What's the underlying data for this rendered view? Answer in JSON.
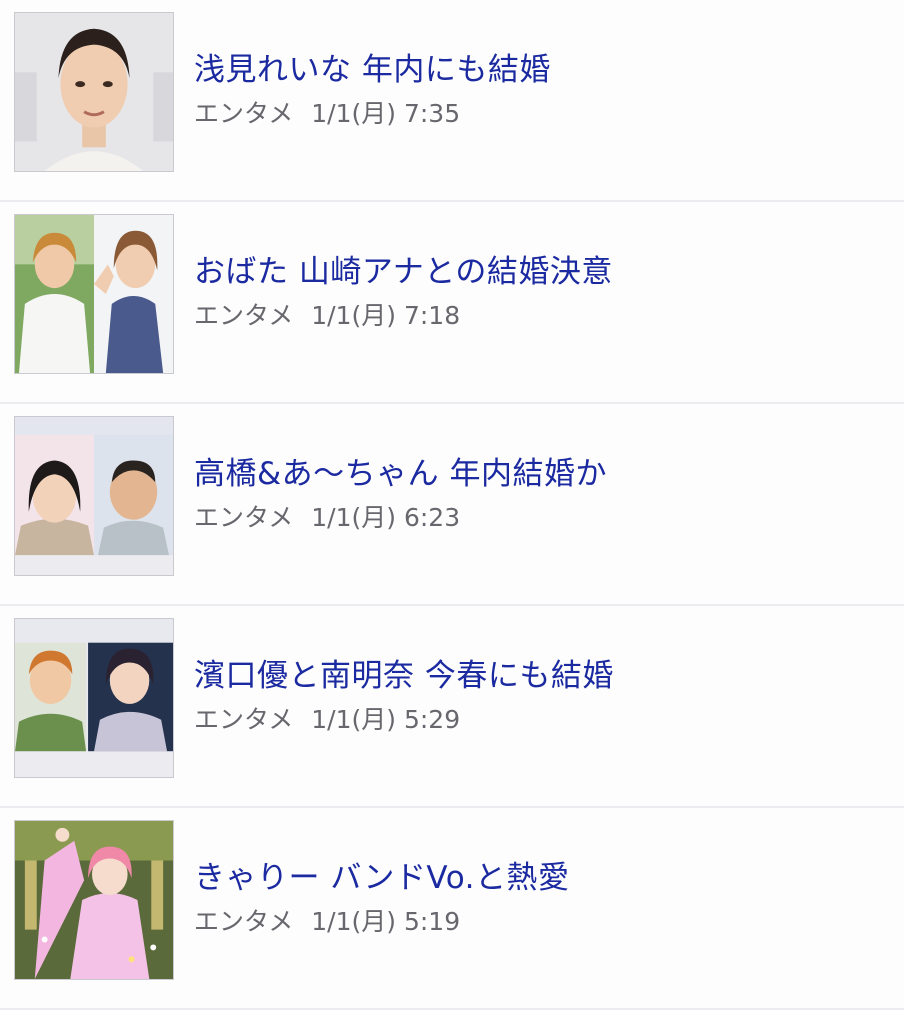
{
  "news": {
    "items": [
      {
        "headline": "浅見れいな 年内にも結婚",
        "category": "エンタメ",
        "datetime": "1/1(月) 7:35",
        "thumbnail_icon": "portrait-photo-icon"
      },
      {
        "headline": "おばた 山崎アナとの結婚決意",
        "category": "エンタメ",
        "datetime": "1/1(月) 7:18",
        "thumbnail_icon": "two-portraits-photo-icon"
      },
      {
        "headline": "高橋&あ〜ちゃん 年内結婚か",
        "category": "エンタメ",
        "datetime": "1/1(月) 6:23",
        "thumbnail_icon": "two-portraits-photo-icon"
      },
      {
        "headline": "濱口優と南明奈 今春にも結婚",
        "category": "エンタメ",
        "datetime": "1/1(月) 5:29",
        "thumbnail_icon": "two-portraits-photo-icon"
      },
      {
        "headline": "きゃりー バンドVo.と熱愛",
        "category": "エンタメ",
        "datetime": "1/1(月) 5:19",
        "thumbnail_icon": "stage-performer-photo-icon"
      }
    ]
  },
  "colors": {
    "headline": "#1b2aa0",
    "meta": "#67676d",
    "divider": "#ececf0"
  }
}
